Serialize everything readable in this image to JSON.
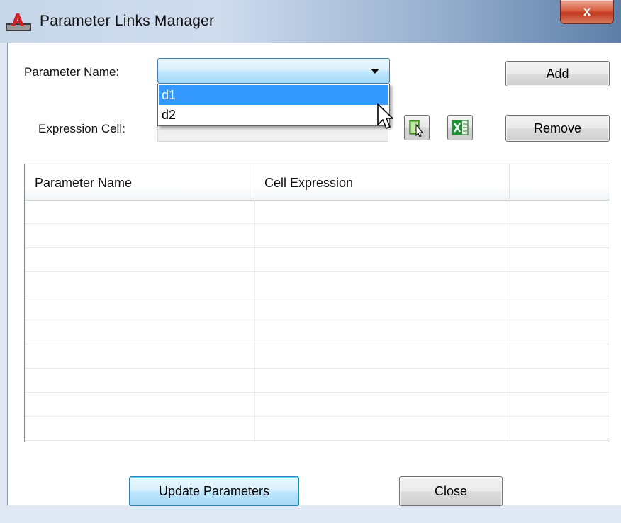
{
  "window": {
    "title": "Parameter Links Manager",
    "close_label": "x"
  },
  "form": {
    "parameter_name_label": "Parameter Name:",
    "parameter_name_value": "",
    "parameter_name_options": [
      "d1",
      "d2"
    ],
    "parameter_name_highlighted": "d1",
    "expression_cell_label": "Expression Cell:",
    "expression_cell_value": ""
  },
  "buttons": {
    "add": "Add",
    "remove": "Remove",
    "update": "Update Parameters",
    "close": "Close"
  },
  "icons": {
    "select_cell": "select-cell-icon",
    "excel": "excel-icon"
  },
  "table": {
    "columns": [
      "Parameter Name",
      "Cell Expression",
      ""
    ],
    "rows": []
  },
  "colors": {
    "selection": "#3399ff",
    "default_button_border": "#3c7fb1",
    "close_button": "#c2381f"
  }
}
